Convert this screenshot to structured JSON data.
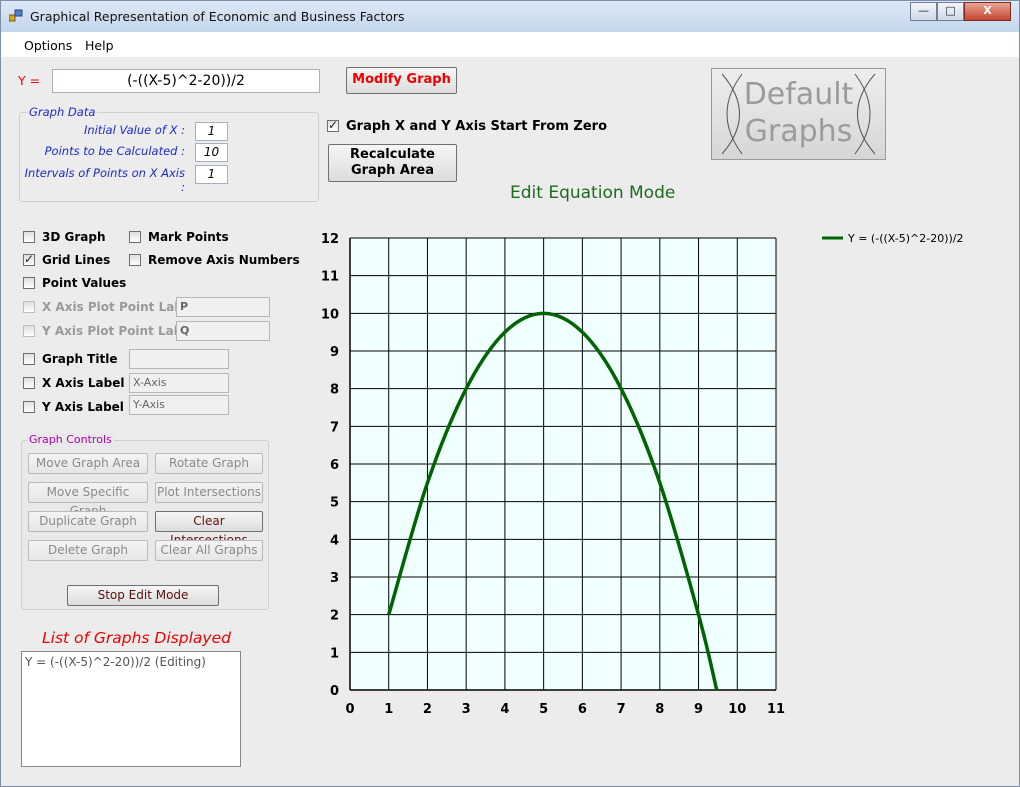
{
  "window": {
    "title": "Graphical Representation of Economic and Business Factors",
    "buttons": {
      "minimize": "—",
      "maximize": "□",
      "close": "X"
    }
  },
  "menu": {
    "items": [
      "Options",
      "Help"
    ]
  },
  "equation": {
    "label": "Y =",
    "value": "(-((X-5)^2-20))/2"
  },
  "buttons": {
    "modify_graph": "Modify Graph",
    "recalculate_line1": "Recalculate",
    "recalculate_line2": "Graph Area",
    "default_graphs_line1": "Default",
    "default_graphs_line2": "Graphs"
  },
  "graph_data": {
    "title": "Graph Data",
    "fields": [
      {
        "label": "Initial Value of X :",
        "value": "1"
      },
      {
        "label": "Points to be Calculated :",
        "value": "10"
      },
      {
        "label": "Intervals of Points on X Axis :",
        "value": "1"
      }
    ]
  },
  "axis_start_zero": {
    "label": "Graph X and Y Axis Start From Zero",
    "checked": true
  },
  "mode_title": "Edit Equation Mode",
  "options": {
    "three_d": {
      "label": "3D Graph",
      "checked": false
    },
    "mark_points": {
      "label": "Mark Points",
      "checked": false
    },
    "grid_lines": {
      "label": "Grid Lines",
      "checked": true
    },
    "remove_axis_numbers": {
      "label": "Remove Axis Numbers",
      "checked": false
    },
    "point_values": {
      "label": "Point Values",
      "checked": false
    },
    "x_plot_label": {
      "label": "X Axis Plot Point Label",
      "value": "P"
    },
    "y_plot_label": {
      "label": "Y Axis Plot Point Label",
      "value": "Q"
    },
    "graph_title": {
      "label": "Graph Title",
      "value": ""
    },
    "x_axis_label": {
      "label": "X Axis Label",
      "value": "X-Axis"
    },
    "y_axis_label": {
      "label": "Y Axis Label",
      "value": "Y-Axis"
    }
  },
  "graph_controls": {
    "title": "Graph Controls",
    "buttons": [
      "Move Graph Area",
      "Rotate Graph",
      "Move Specific Graph",
      "Plot Intersections",
      "Duplicate Graph",
      "Clear Intersections",
      "Delete Graph",
      "Clear All Graphs"
    ],
    "stop_edit": "Stop Edit Mode"
  },
  "graph_list": {
    "title": "List of Graphs Displayed",
    "items": [
      "Y = (-((X-5)^2-20))/2 (Editing)"
    ]
  },
  "chart_data": {
    "type": "line",
    "title": "",
    "xlabel": "",
    "ylabel": "",
    "xlim": [
      0,
      11
    ],
    "ylim": [
      0,
      12
    ],
    "x_ticks": [
      "0",
      "1",
      "2",
      "3",
      "4",
      "5",
      "6",
      "7",
      "8",
      "9",
      "10",
      "11"
    ],
    "y_ticks": [
      "0",
      "1",
      "2",
      "3",
      "4",
      "5",
      "6",
      "7",
      "8",
      "9",
      "10",
      "11",
      "12"
    ],
    "grid": true,
    "legend_position": "right",
    "plot_background": "#f0ffff",
    "series": [
      {
        "name": "Y = (-((X-5)^2-20))/2",
        "color": "#006400",
        "x": [
          1,
          2,
          3,
          4,
          5,
          6,
          7,
          8,
          9,
          9.47
        ],
        "y": [
          2,
          5.5,
          8,
          9.5,
          10,
          9.5,
          8,
          5.5,
          2,
          0
        ]
      }
    ]
  }
}
